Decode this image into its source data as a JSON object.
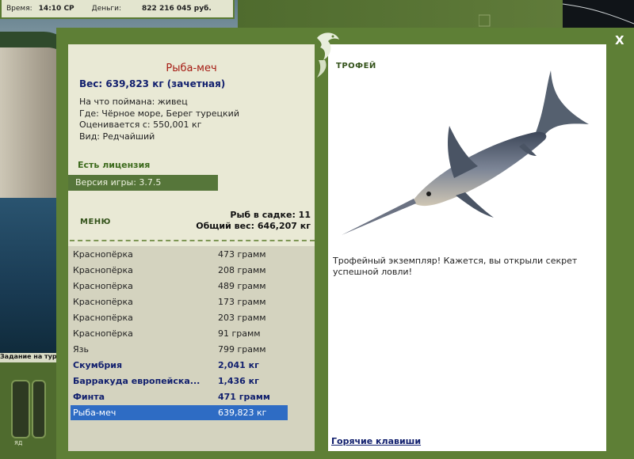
{
  "status": {
    "time_label": "Время:",
    "time_value": "14:10 СР",
    "money_label": "Деньги:",
    "money_value": "822 216 045 руб."
  },
  "taskbar": {
    "text": "Задание на тур",
    "slot_label": "ЯД"
  },
  "close_label": "X",
  "fish": {
    "name": "Рыба-меч",
    "weight": "Вес: 639,823 кг (зачетная)",
    "caught_with": "На что поймана: живец",
    "where": "Где: Чёрное море, Берег турецкий",
    "valued_from": "Оценивается с: 550,001 кг",
    "kind": "Вид: Редчайший"
  },
  "license": "Есть лицензия",
  "version": "Версия игры: 3.7.5",
  "menu_label": "МЕНЮ",
  "stats": {
    "fish_in_keepnet": "Рыб в садке: 11",
    "total_weight": "Общий вес: 646,207 кг"
  },
  "catch_list": [
    {
      "name": "Краснопёрка",
      "weight": "473 грамм",
      "style": "normal"
    },
    {
      "name": "Краснопёрка",
      "weight": "208 грамм",
      "style": "normal"
    },
    {
      "name": "Краснопёрка",
      "weight": "489 грамм",
      "style": "normal"
    },
    {
      "name": "Краснопёрка",
      "weight": "173 грамм",
      "style": "normal"
    },
    {
      "name": "Краснопёрка",
      "weight": "203 грамм",
      "style": "normal"
    },
    {
      "name": "Краснопёрка",
      "weight": "91 грамм",
      "style": "normal"
    },
    {
      "name": "Язь",
      "weight": "799 грамм",
      "style": "normal"
    },
    {
      "name": "Скумбрия",
      "weight": "2,041 кг",
      "style": "bold"
    },
    {
      "name": "Барракуда европейска...",
      "weight": "1,436 кг",
      "style": "bold"
    },
    {
      "name": "Финта",
      "weight": "471 грамм",
      "style": "bold"
    },
    {
      "name": "Рыба-меч",
      "weight": "639,823 кг",
      "style": "selected"
    }
  ],
  "trophy": {
    "label": "ТРОФЕЙ",
    "text": "Трофейный экземпляр! Кажется, вы открыли секрет успешной ловли!"
  },
  "hotkeys": "Горячие клавиши",
  "colors": {
    "frame": "#5e7f36",
    "panel": "#e9e9d5",
    "list_bg": "#d4d3bf",
    "selected": "#2e6cc4",
    "fish_name": "#a51a12",
    "navy": "#12206e"
  },
  "icons": [
    "fish-emblem-icon",
    "close-icon",
    "swordfish-image"
  ]
}
